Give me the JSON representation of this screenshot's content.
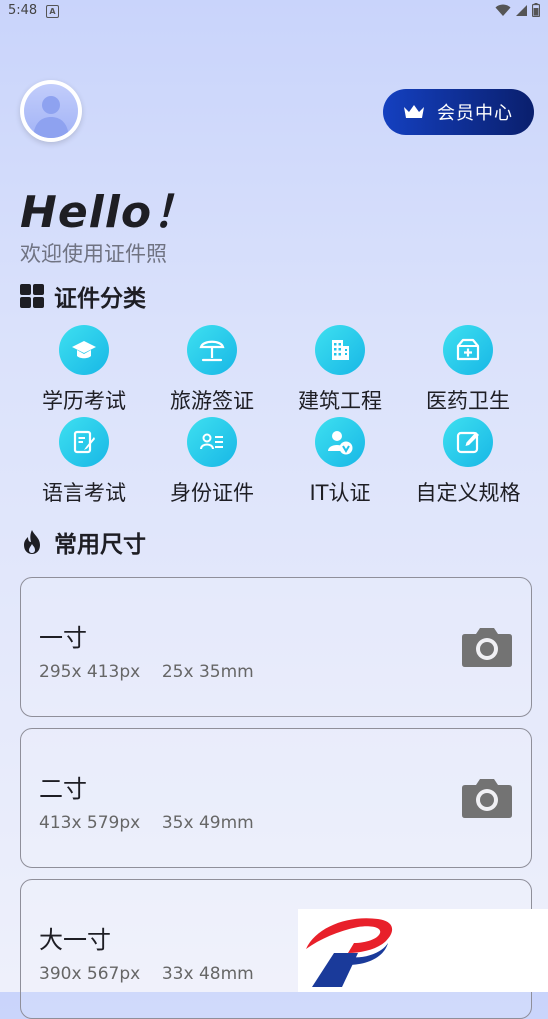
{
  "status_bar": {
    "time": "5:48",
    "badge": "A"
  },
  "header": {
    "vip_label": "会员中心"
  },
  "greeting": {
    "hello": "Hello！",
    "welcome": "欢迎使用证件照"
  },
  "categories_section": {
    "title": "证件分类",
    "items": [
      {
        "label": "学历考试",
        "icon": "graduation-cap-icon"
      },
      {
        "label": "旅游签证",
        "icon": "beach-umbrella-icon"
      },
      {
        "label": "建筑工程",
        "icon": "building-icon"
      },
      {
        "label": "医药卫生",
        "icon": "medical-kit-icon"
      },
      {
        "label": "语言考试",
        "icon": "document-pen-icon"
      },
      {
        "label": "身份证件",
        "icon": "id-card-icon"
      },
      {
        "label": "IT认证",
        "icon": "user-verified-icon"
      },
      {
        "label": "自定义规格",
        "icon": "edit-icon"
      }
    ]
  },
  "sizes_section": {
    "title": "常用尺寸",
    "items": [
      {
        "name": "一寸",
        "pixels": "295x 413px",
        "mm": "25x 35mm"
      },
      {
        "name": "二寸",
        "pixels": "413x 579px",
        "mm": "35x 49mm"
      },
      {
        "name": "大一寸",
        "pixels": "390x 567px",
        "mm": "33x 48mm"
      }
    ]
  },
  "colors": {
    "accent_cyan": "#22c3ea",
    "vip_dark": "#0a1f6d",
    "logo_red": "#e8202a",
    "logo_blue": "#1a3a9a"
  }
}
